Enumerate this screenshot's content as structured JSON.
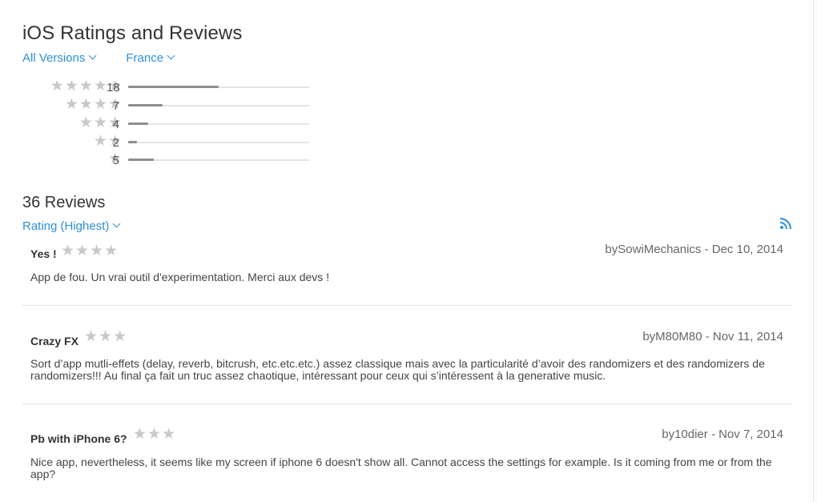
{
  "header": {
    "title": "iOS Ratings and Reviews",
    "versions_label": "All Versions",
    "country_label": "France"
  },
  "distribution": [
    {
      "stars": 5,
      "count": "18",
      "fraction": 0.5
    },
    {
      "stars": 4,
      "count": "7",
      "fraction": 0.19
    },
    {
      "stars": 3,
      "count": "4",
      "fraction": 0.11
    },
    {
      "stars": 2,
      "count": "2",
      "fraction": 0.05
    },
    {
      "stars": 1,
      "count": "5",
      "fraction": 0.14
    }
  ],
  "reviews_section": {
    "title": "36 Reviews",
    "sort_label": "Rating (Highest)",
    "rss_icon": "rss-feed-icon",
    "star_color": "#c8c8c8",
    "accent": "#2b8fe0"
  },
  "reviews": [
    {
      "title": "Yes !",
      "stars": 4,
      "byline": "bySowiMechanics - Dec 10, 2014",
      "body": "App de fou. Un vrai outil d'experimentation. Merci aux devs !"
    },
    {
      "title": "Crazy FX",
      "stars": 3,
      "byline": "byM80M80 - Nov 11, 2014",
      "body": "Sort d’app mutli-effets (delay, reverb, bitcrush, etc.etc.etc.) assez classique mais avec la particularité d’avoir des randomizers et des randomizers de randomizers!!! Au final ça fait un truc assez chaotique, intéressant pour ceux qui s’intéressent à la generative music."
    },
    {
      "title": "Pb with iPhone 6?",
      "stars": 3,
      "byline": "by10dier - Nov 7, 2014",
      "body": "Nice app, nevertheless, it seems like my screen if iphone 6 doesn't show all. Cannot access the settings for example. Is it coming from me or from the app?"
    }
  ]
}
